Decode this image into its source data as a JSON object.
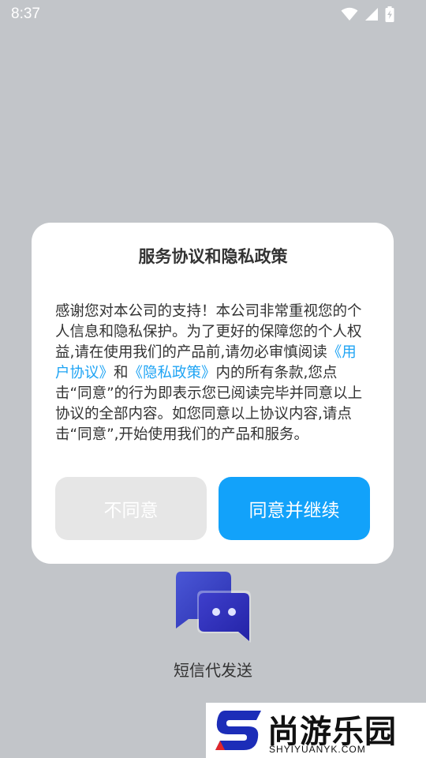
{
  "status_bar": {
    "time": "8:37",
    "icons": [
      "wifi-icon",
      "signal-icon",
      "battery-charging-icon"
    ]
  },
  "dialog": {
    "title": "服务协议和隐私政策",
    "body": {
      "intro": "感谢您对本公司的支持！本公司非常重视您的个人信息和隐私保护。为了更好的保障您的个人权益,请在使用我们的产品前,请勿必审慎阅读",
      "user_agreement_link": "《用户协议》",
      "and_text": "和",
      "privacy_policy_link": "《隐私政策》",
      "outro": "内的所有条款,您点击“同意”的行为即表示您已阅读完毕并同意以上协议的全部内容。如您同意以上协议内容,请点击“同意”,开始使用我们的产品和服务。"
    },
    "disagree_label": "不同意",
    "agree_label": "同意并继续"
  },
  "app": {
    "name": "短信代发送",
    "logo_icon": "chat-bubbles-icon"
  },
  "watermark": {
    "title": "尚游乐园",
    "url": "SHYIYUANYK.COM",
    "logo_icon": "s-logo-icon"
  },
  "colors": {
    "accent": "#12a2fa",
    "link": "#1fa4f4",
    "background": "#c2c5c9",
    "disabled_button": "#e6e6e6"
  }
}
